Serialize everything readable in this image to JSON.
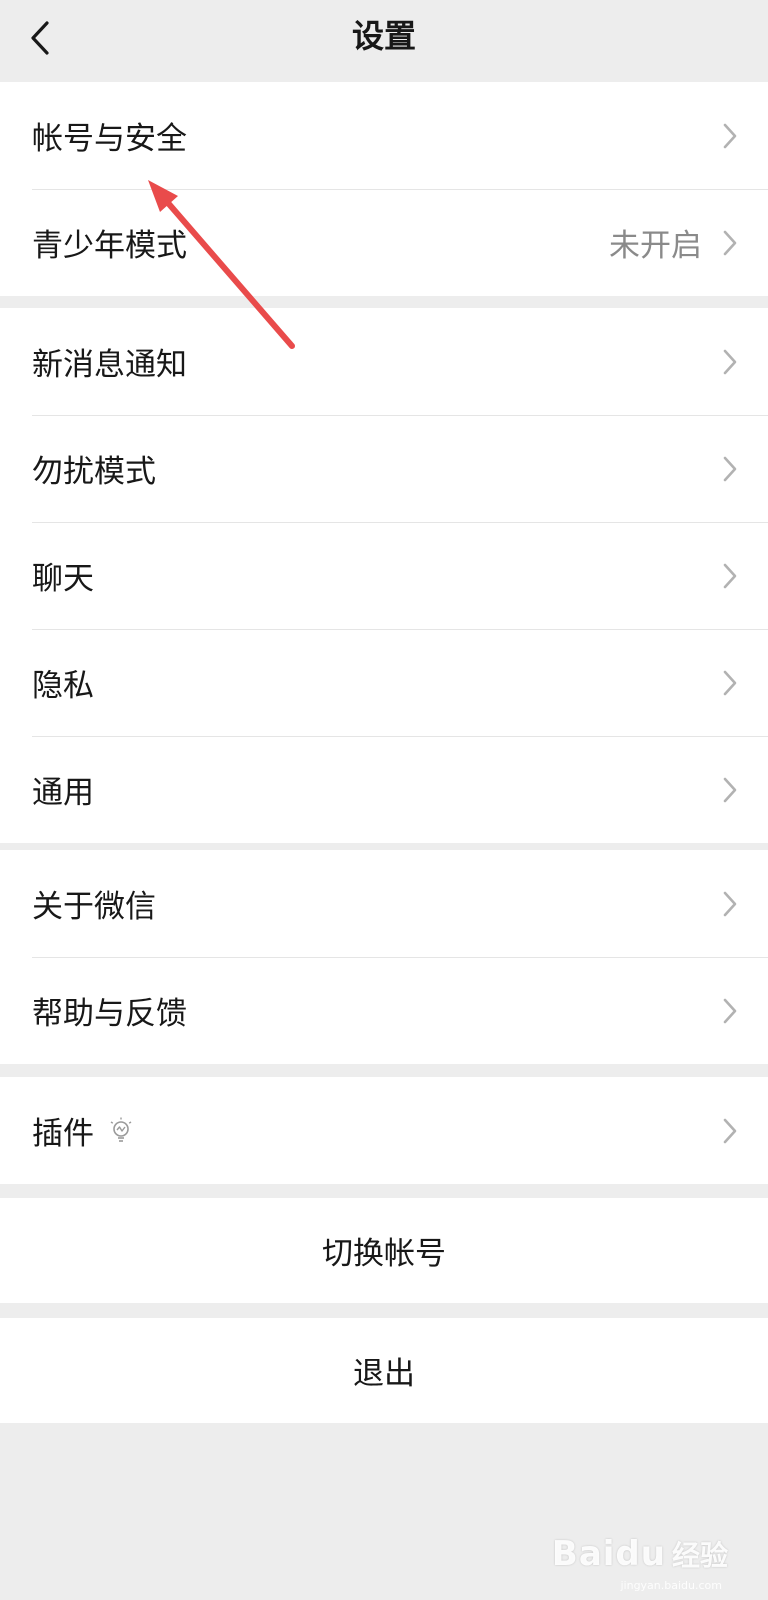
{
  "header": {
    "title": "设置",
    "back_icon": "chevron-left-icon"
  },
  "group1": {
    "items": [
      {
        "label": "帐号与安全",
        "value": ""
      },
      {
        "label": "青少年模式",
        "value": "未开启"
      }
    ]
  },
  "group2": {
    "items": [
      {
        "label": "新消息通知"
      },
      {
        "label": "勿扰模式"
      },
      {
        "label": "聊天"
      },
      {
        "label": "隐私"
      },
      {
        "label": "通用"
      }
    ]
  },
  "group3": {
    "items": [
      {
        "label": "关于微信"
      },
      {
        "label": "帮助与反馈"
      }
    ]
  },
  "group4": {
    "items": [
      {
        "label": "插件",
        "icon": "lightbulb-icon"
      }
    ]
  },
  "actions": {
    "switch_account": "切换帐号",
    "logout": "退出"
  },
  "watermark": {
    "brand": "Baidu",
    "suffix": "经验",
    "url": "jingyan.baidu.com"
  },
  "colors": {
    "background": "#ededed",
    "row_bg": "#ffffff",
    "annotation_arrow": "#e94b4b",
    "secondary_text": "#8a8a8a"
  }
}
